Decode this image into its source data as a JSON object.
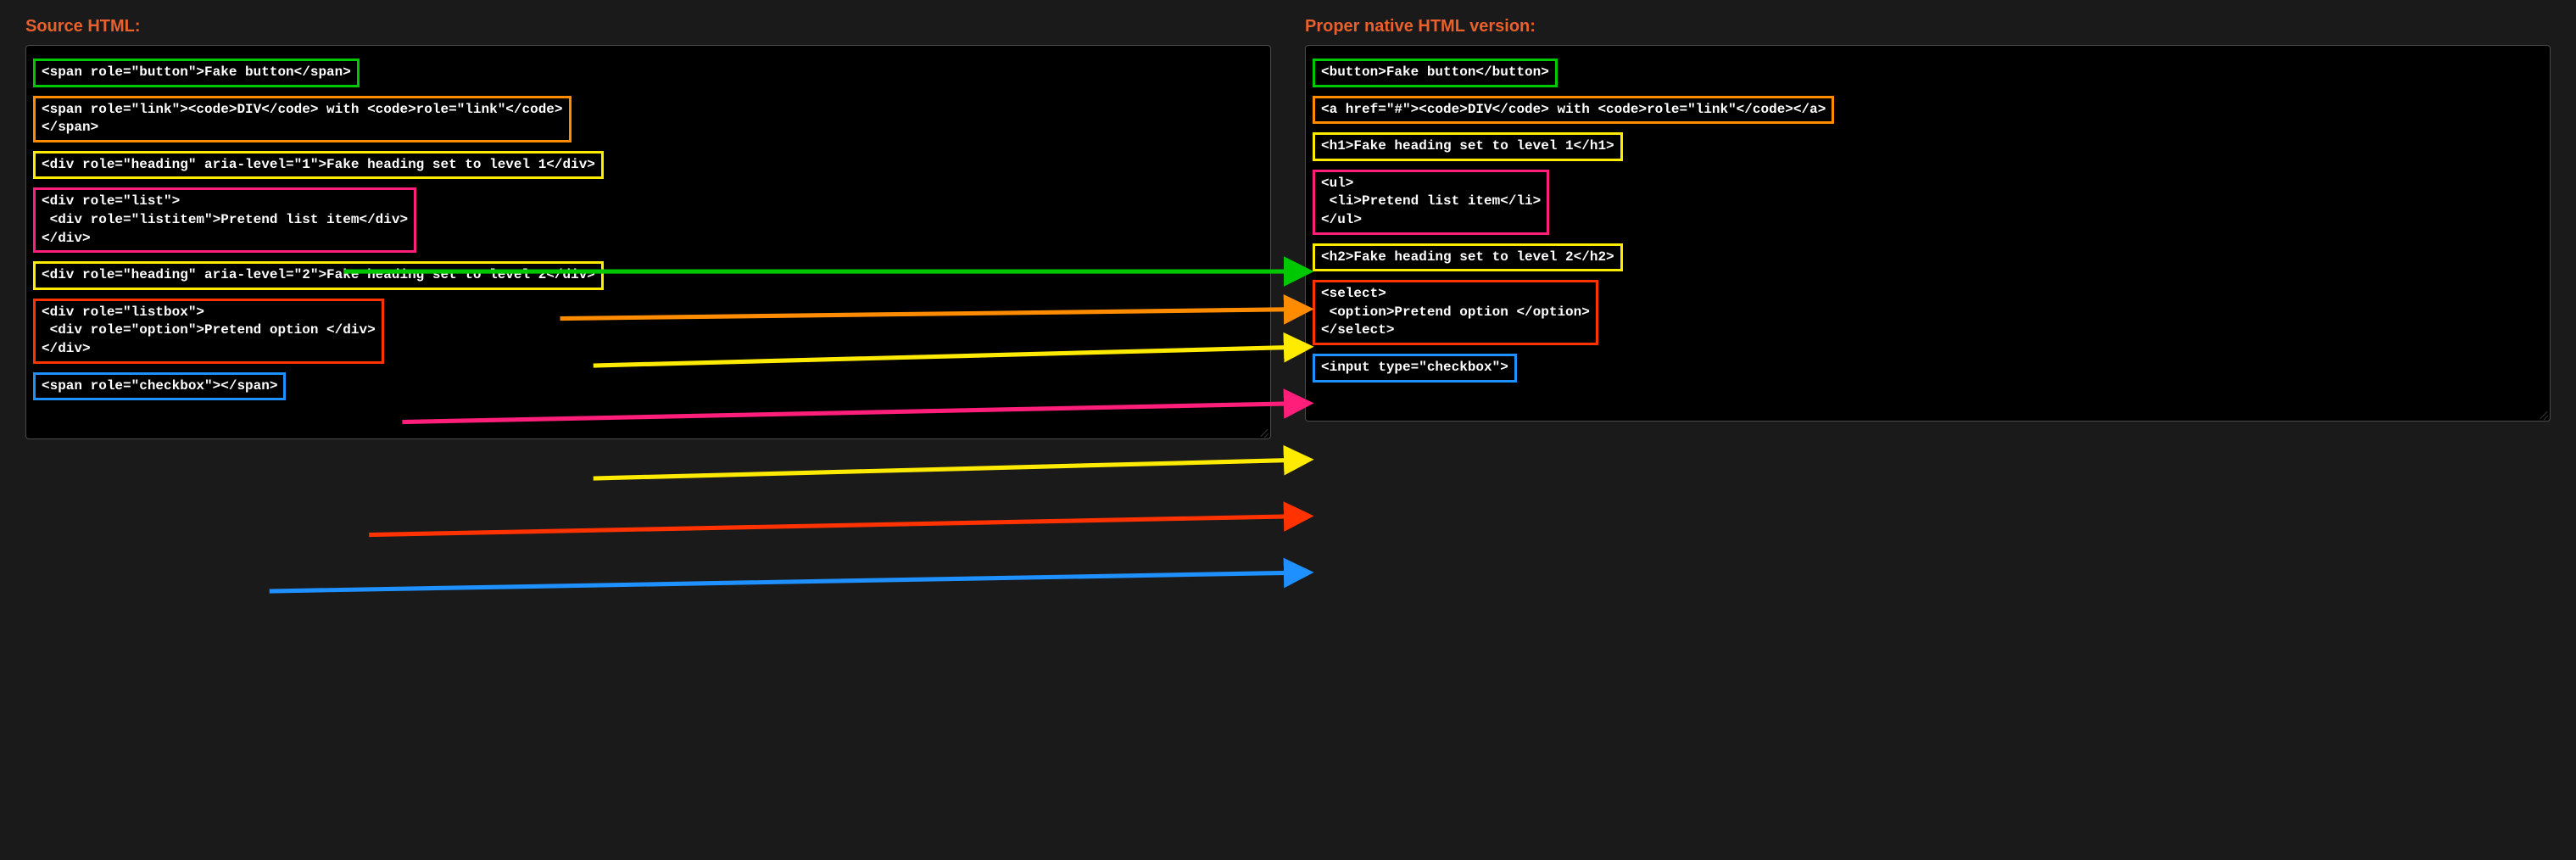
{
  "left": {
    "title": "Source HTML:",
    "items": [
      {
        "color": "green",
        "code": "<span role=\"button\">Fake button</span>"
      },
      {
        "color": "orange",
        "code": "<span role=\"link\"><code>DIV</code> with <code>role=\"link\"</code>\n</span>"
      },
      {
        "color": "yellow",
        "code": "<div role=\"heading\" aria-level=\"1\">Fake heading set to level 1</div>"
      },
      {
        "color": "magenta",
        "code": "<div role=\"list\">\n <div role=\"listitem\">Pretend list item</div>\n</div>"
      },
      {
        "color": "yellow",
        "code": "<div role=\"heading\" aria-level=\"2\">Fake heading set to level 2</div>"
      },
      {
        "color": "red",
        "code": "<div role=\"listbox\">\n <div role=\"option\">Pretend option </div>\n</div>"
      },
      {
        "color": "blue",
        "code": "<span role=\"checkbox\"></span>"
      }
    ]
  },
  "right": {
    "title": "Proper native HTML version:",
    "items": [
      {
        "color": "green",
        "code": "<button>Fake button</button>"
      },
      {
        "color": "orange",
        "code": "<a href=\"#\"><code>DIV</code> with <code>role=\"link\"</code></a>"
      },
      {
        "color": "yellow",
        "code": "<h1>Fake heading set to level 1</h1>"
      },
      {
        "color": "magenta",
        "code": "<ul>\n <li>Pretend list item</li>\n</ul>"
      },
      {
        "color": "yellow",
        "code": "<h2>Fake heading set to level 2</h2>"
      },
      {
        "color": "red",
        "code": "<select>\n <option>Pretend option </option>\n</select>"
      },
      {
        "color": "blue",
        "code": "<input type=\"checkbox\">"
      }
    ]
  },
  "arrow_colors": {
    "green": "#00c800",
    "orange": "#ff8c00",
    "yellow": "#ffeb00",
    "magenta": "#ff1e7a",
    "red": "#ff3200",
    "blue": "#1e90ff"
  }
}
